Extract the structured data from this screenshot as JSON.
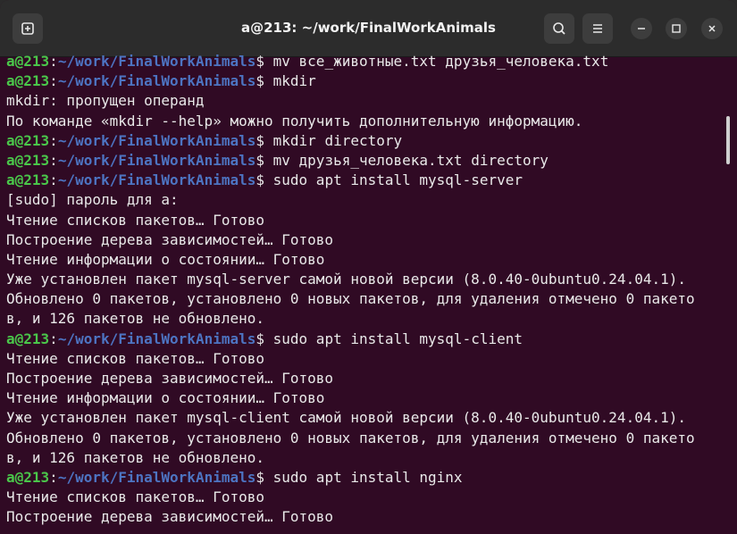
{
  "window": {
    "title": "a@213: ~/work/FinalWorkAnimals",
    "new_tab_icon": "new-tab-icon",
    "search_icon": "search-icon",
    "menu_icon": "hamburger-menu-icon",
    "minimize_icon": "minimize-icon",
    "maximize_icon": "maximize-icon",
    "close_icon": "close-icon"
  },
  "colors": {
    "terminal_bg": "#300a24",
    "prompt_user": "#4ac64a",
    "prompt_path": "#4d74c2",
    "text": "#e9e9e9",
    "titlebar_bg": "#2c2c2c"
  },
  "terminal": {
    "lines": [
      {
        "user": "a@213",
        "sep": ":",
        "path": "~/work/FinalWorkAnimals",
        "cmd": "$ mv все_животные.txt друзья_человека.txt"
      },
      {
        "user": "a@213",
        "sep": ":",
        "path": "~/work/FinalWorkAnimals",
        "cmd": "$ mkdir"
      },
      {
        "text": "mkdir: пропущен операнд"
      },
      {
        "text": "По команде «mkdir --help» можно получить дополнительную информацию."
      },
      {
        "user": "a@213",
        "sep": ":",
        "path": "~/work/FinalWorkAnimals",
        "cmd": "$ mkdir directory"
      },
      {
        "user": "a@213",
        "sep": ":",
        "path": "~/work/FinalWorkAnimals",
        "cmd": "$ mv друзья_человека.txt directory"
      },
      {
        "user": "a@213",
        "sep": ":",
        "path": "~/work/FinalWorkAnimals",
        "cmd": "$ sudo apt install mysql-server"
      },
      {
        "text": "[sudo] пароль для a:"
      },
      {
        "text": "Чтение списков пакетов… Готово"
      },
      {
        "text": "Построение дерева зависимостей… Готово"
      },
      {
        "text": "Чтение информации о состоянии… Готово"
      },
      {
        "text": "Уже установлен пакет mysql-server самой новой версии (8.0.40-0ubuntu0.24.04.1)."
      },
      {
        "text": "Обновлено 0 пакетов, установлено 0 новых пакетов, для удаления отмечено 0 пакето"
      },
      {
        "text": "в, и 126 пакетов не обновлено."
      },
      {
        "user": "a@213",
        "sep": ":",
        "path": "~/work/FinalWorkAnimals",
        "cmd": "$ sudo apt install mysql-client"
      },
      {
        "text": "Чтение списков пакетов… Готово"
      },
      {
        "text": "Построение дерева зависимостей… Готово"
      },
      {
        "text": "Чтение информации о состоянии… Готово"
      },
      {
        "text": "Уже установлен пакет mysql-client самой новой версии (8.0.40-0ubuntu0.24.04.1)."
      },
      {
        "text": "Обновлено 0 пакетов, установлено 0 новых пакетов, для удаления отмечено 0 пакето"
      },
      {
        "text": "в, и 126 пакетов не обновлено."
      },
      {
        "user": "a@213",
        "sep": ":",
        "path": "~/work/FinalWorkAnimals",
        "cmd": "$ sudo apt install nginx"
      },
      {
        "text": "Чтение списков пакетов… Готово"
      },
      {
        "text": "Построение дерева зависимостей… Готово"
      }
    ]
  }
}
